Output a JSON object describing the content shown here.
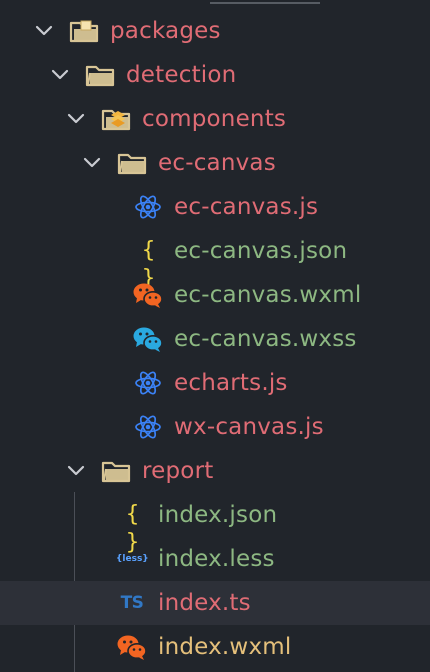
{
  "explorer": {
    "items": [
      {
        "label": "packages",
        "type": "folder",
        "expanded": true,
        "depth": 0,
        "icon": "package-folder-icon",
        "color": "#e06c75"
      },
      {
        "label": "detection",
        "type": "folder",
        "expanded": true,
        "depth": 1,
        "icon": "folder-icon",
        "color": "#e06c75"
      },
      {
        "label": "components",
        "type": "folder",
        "expanded": true,
        "depth": 2,
        "icon": "components-folder-icon",
        "color": "#e06c75"
      },
      {
        "label": "ec-canvas",
        "type": "folder",
        "expanded": true,
        "depth": 3,
        "icon": "folder-icon",
        "color": "#e06c75"
      },
      {
        "label": "ec-canvas.js",
        "type": "file",
        "depth": 4,
        "icon": "react-icon",
        "color": "#e06c75"
      },
      {
        "label": "ec-canvas.json",
        "type": "file",
        "depth": 4,
        "icon": "json-braces-icon",
        "color": "#8db882"
      },
      {
        "label": "ec-canvas.wxml",
        "type": "file",
        "depth": 4,
        "icon": "wechat-orange-icon",
        "color": "#8db882"
      },
      {
        "label": "ec-canvas.wxss",
        "type": "file",
        "depth": 4,
        "icon": "wechat-blue-icon",
        "color": "#8db882"
      },
      {
        "label": "echarts.js",
        "type": "file",
        "depth": 4,
        "icon": "react-icon",
        "color": "#e06c75"
      },
      {
        "label": "wx-canvas.js",
        "type": "file",
        "depth": 4,
        "icon": "react-icon",
        "color": "#e06c75"
      },
      {
        "label": "report",
        "type": "folder",
        "expanded": true,
        "depth": 2,
        "icon": "folder-icon",
        "color": "#e06c75"
      },
      {
        "label": "index.json",
        "type": "file",
        "depth": 3,
        "icon": "json-braces-icon",
        "color": "#8db882"
      },
      {
        "label": "index.less",
        "type": "file",
        "depth": 3,
        "icon": "less-icon",
        "color": "#8db882"
      },
      {
        "label": "index.ts",
        "type": "file",
        "depth": 3,
        "icon": "typescript-icon",
        "color": "#e06c75",
        "selected": true
      },
      {
        "label": "index.wxml",
        "type": "file",
        "depth": 3,
        "icon": "wechat-orange-icon",
        "color": "#e5c07b"
      }
    ]
  },
  "colors": {
    "background": "#21252b",
    "selected_row": "#2d3038",
    "chevron": "#c9cbd1",
    "folder": "#d8c596",
    "react": "#3b82f6",
    "json": "#f1d94a",
    "wechat_orange": "#f26522",
    "wechat_blue": "#2aa9e0",
    "less_text": "#5aa2ff",
    "typescript": "#3178c6"
  }
}
